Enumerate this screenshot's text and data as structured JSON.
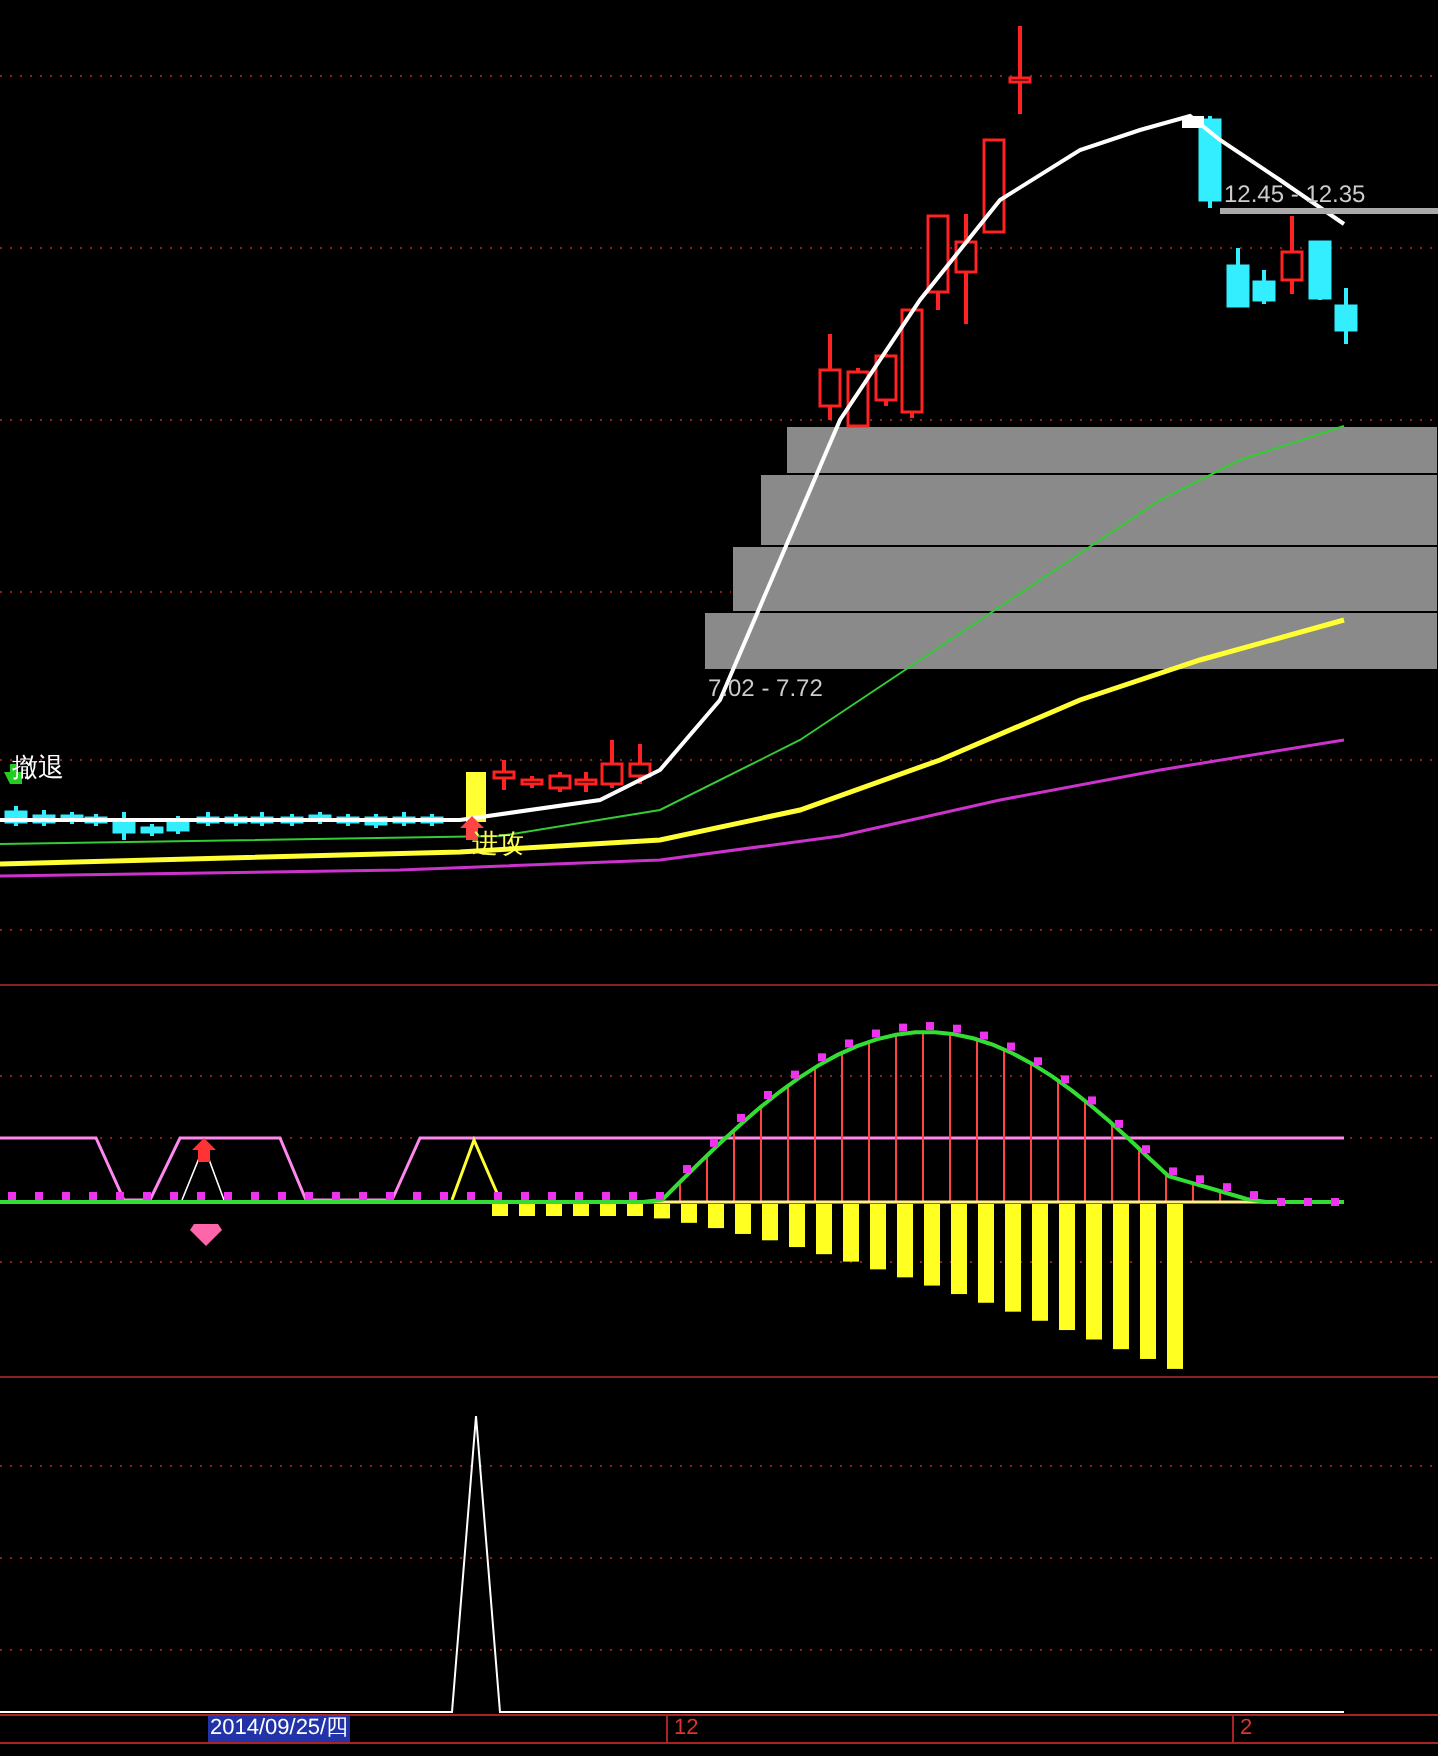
{
  "main_chart": {
    "signals": [
      {
        "label": "撤退",
        "kind": "sell"
      },
      {
        "label": "进攻",
        "kind": "buy"
      }
    ],
    "zone_labels": [
      {
        "text": "7.02 - 7.72"
      },
      {
        "text": "12.45 - 12.35"
      }
    ]
  },
  "time_axis": {
    "cursor_date": "2014/09/25/四",
    "ticks": [
      "12",
      "2"
    ]
  }
}
